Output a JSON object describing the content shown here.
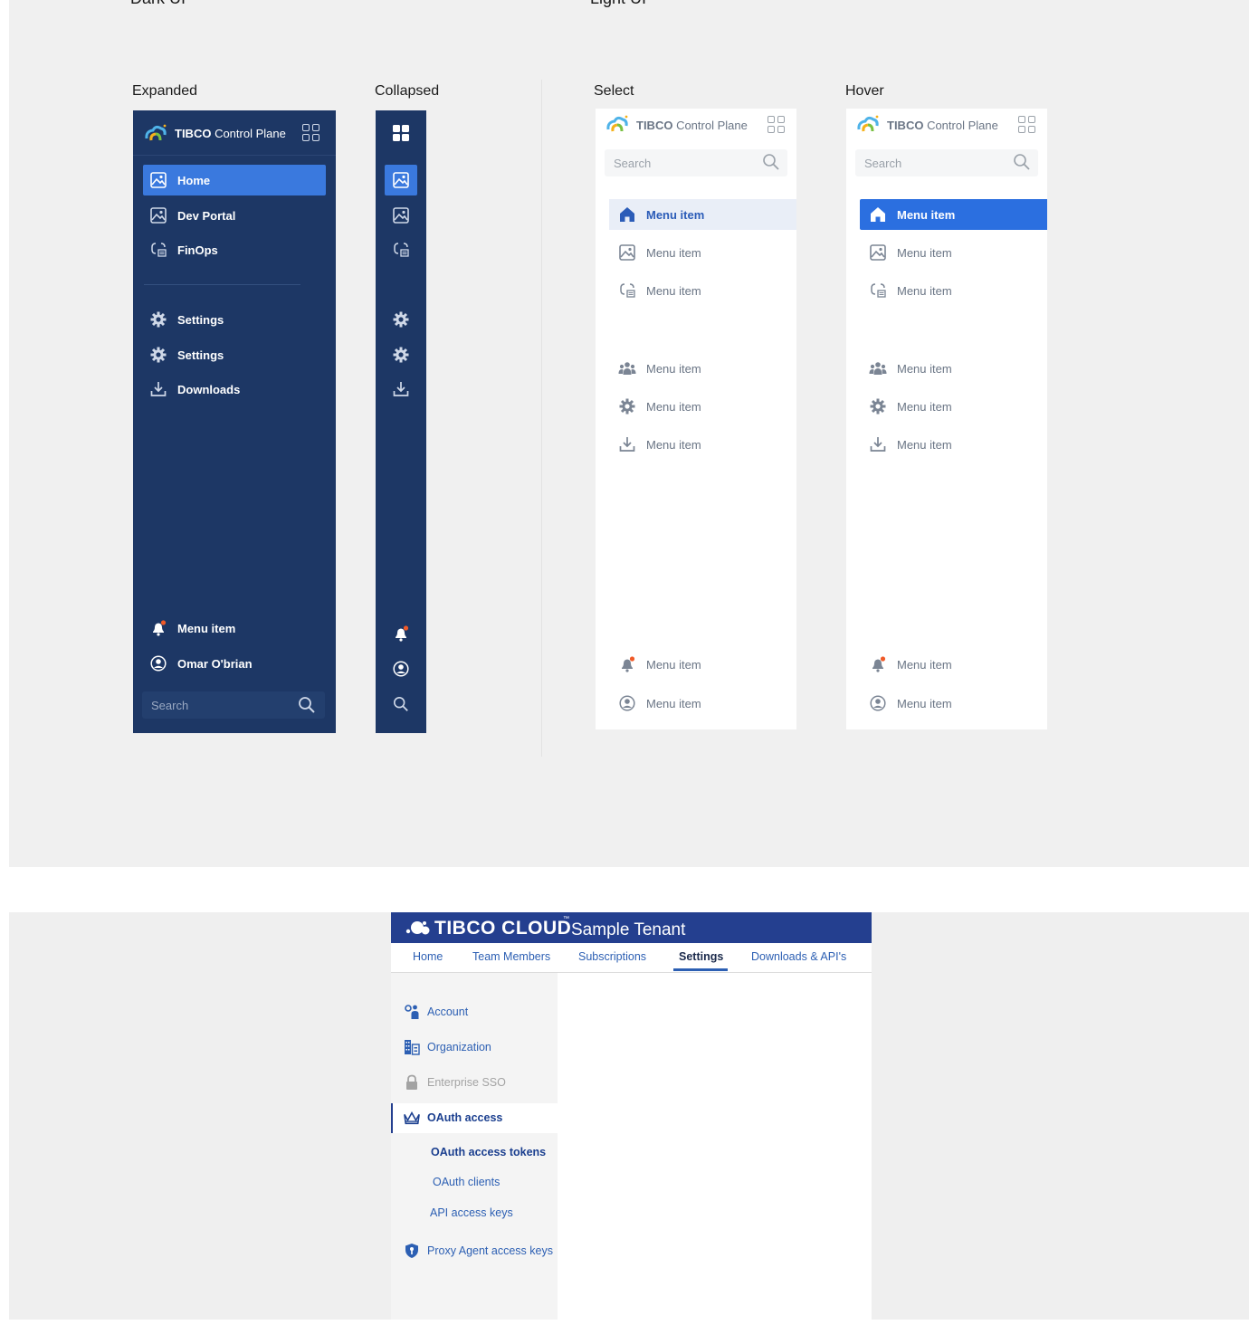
{
  "sections": {
    "dark": "Dark UI",
    "light": "Light UI"
  },
  "labels": {
    "expanded": "Expanded",
    "collapsed": "Collapsed",
    "select": "Select",
    "hover": "Hover"
  },
  "brand": {
    "bold": "TIBCO",
    "rest": " Control Plane"
  },
  "dark_nav": {
    "items": [
      {
        "label": "Home",
        "icon": "image-icon",
        "active": true
      },
      {
        "label": "Dev Portal",
        "icon": "image-icon"
      },
      {
        "label": "FinOps",
        "icon": "finops-icon"
      },
      {
        "label": "Settings",
        "icon": "gear-icon"
      },
      {
        "label": "Settings",
        "icon": "gear-icon"
      },
      {
        "label": "Downloads",
        "icon": "download-icon"
      }
    ],
    "footer": [
      {
        "label": "Menu item",
        "icon": "bell-icon"
      },
      {
        "label": "Omar O'brian",
        "icon": "user-circle-icon"
      }
    ],
    "search_placeholder": "Search"
  },
  "light_nav": {
    "search_placeholder": "Search",
    "items": [
      "Menu item",
      "Menu item",
      "Menu item",
      "Menu item",
      "Menu item",
      "Menu item"
    ],
    "footer": [
      "Menu item",
      "Menu item"
    ]
  },
  "tenant": {
    "brand": "TIBCO CLOUD",
    "tm": "™",
    "tenant_name": "Sample Tenant",
    "tabs": [
      "Home",
      "Team Members",
      "Subscriptions",
      "Settings",
      "Downloads & API's"
    ],
    "active_tab": "Settings",
    "side": [
      {
        "label": "Account",
        "icon": "account-icon"
      },
      {
        "label": "Organization",
        "icon": "building-icon"
      },
      {
        "label": "Enterprise SSO",
        "icon": "lock-icon",
        "disabled": true
      },
      {
        "label": "OAuth access",
        "icon": "crown-icon",
        "active": true
      },
      {
        "label": "Proxy Agent access keys",
        "icon": "shield-icon"
      }
    ],
    "sub": [
      "OAuth access tokens",
      "OAuth clients",
      "API access keys"
    ]
  },
  "colors": {
    "dark_bg": "#1d3765",
    "accent": "#3a79de",
    "header_blue": "#243f8f",
    "link": "#2c5fb3"
  }
}
